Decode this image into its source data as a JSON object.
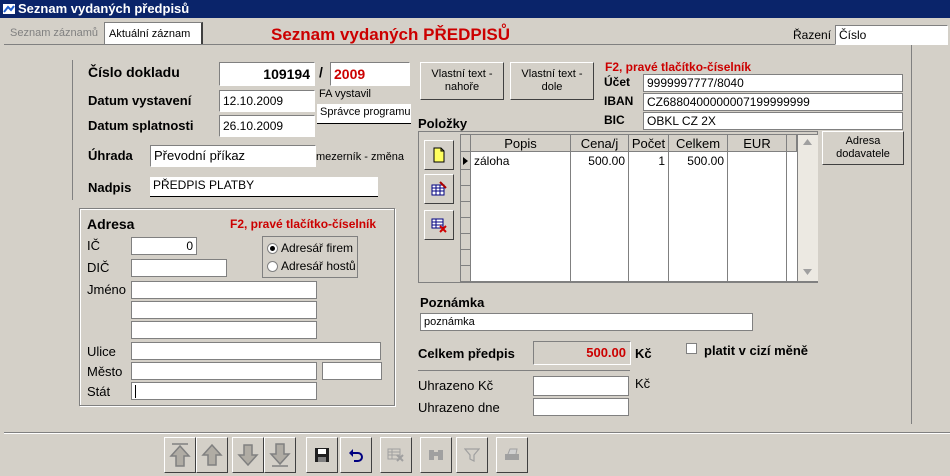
{
  "window": {
    "title": "Seznam vydaných předpisů"
  },
  "tabs": [
    {
      "label": "Seznam záznamů",
      "active": false
    },
    {
      "label": "Aktuální záznam",
      "active": true
    }
  ],
  "header": {
    "title": "Seznam vydaných PŘEDPISŮ"
  },
  "sort": {
    "label": "Řazení",
    "value": "Číslo"
  },
  "doc": {
    "number_label": "Číslo dokladu",
    "number": "109194",
    "year_sep": "/",
    "year": "2009",
    "issued_label": "Datum vystavení",
    "issued": "12.10.2009",
    "due_label": "Datum splatnosti",
    "due": "26.10.2009",
    "issued_by_label": "FA vystavil",
    "issued_by": "Správce programu",
    "payment_label": "Úhrada",
    "payment": "Převodní příkaz",
    "payment_note": "mezerník - změna",
    "caption_label": "Nadpis",
    "caption": "PŘEDPIS PLATBY"
  },
  "buttons": {
    "text_top": "Vlastní text - nahoře",
    "text_bottom": "Vlastní text - dole",
    "supplier_address": "Adresa dodavatele"
  },
  "bank": {
    "hint": "F2, pravé tlačítko-číselník",
    "account_label": "Účet",
    "account": "9999997777/8040",
    "iban_label": "IBAN",
    "iban": "CZ6880400000007199999999",
    "bic_label": "BIC",
    "bic": "OBKL CZ 2X"
  },
  "items": {
    "label": "Položky",
    "columns": [
      "Popis",
      "Cena/j",
      "Počet",
      "Celkem",
      "EUR"
    ],
    "rows": [
      {
        "popis": "záloha",
        "cena": "500.00",
        "pocet": "1",
        "celkem": "500.00",
        "eur": ""
      }
    ]
  },
  "address": {
    "label": "Adresa",
    "hint": "F2, pravé tlačítko-číselník",
    "ic_label": "IČ",
    "ic": "0",
    "dic_label": "DIČ",
    "dic": "",
    "name_label": "Jméno",
    "street_label": "Ulice",
    "city_label": "Město",
    "country_label": "Stát",
    "radio_firms": "Adresář firem",
    "radio_guests": "Adresář hostů"
  },
  "note": {
    "label": "Poznámka",
    "value": "poznámka"
  },
  "totals": {
    "total_label": "Celkem předpis",
    "total": "500.00",
    "currency": "Kč",
    "foreign_label": "platit v cizí měně",
    "paid_label": "Uhrazeno Kč",
    "paid_currency": "Kč",
    "paid_date_label": "Uhrazeno dne"
  },
  "colors": {
    "titlebar": "#0a246a",
    "accent_red": "#cc0000",
    "face": "#d4d0c8"
  }
}
